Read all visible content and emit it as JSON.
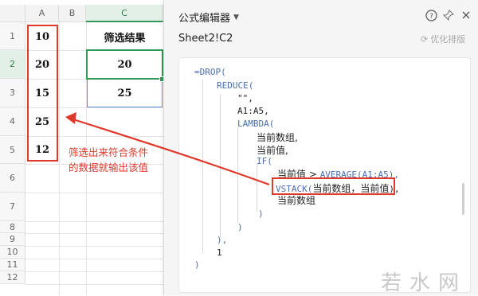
{
  "sheet": {
    "columns": [
      "A",
      "B",
      "C"
    ],
    "rows": [
      "1",
      "2",
      "3",
      "4",
      "5",
      "6",
      "7",
      "8",
      "9",
      "10",
      "11",
      "12"
    ],
    "column_a_values": [
      "10",
      "20",
      "15",
      "25",
      "12"
    ],
    "c1_header": "筛选结果",
    "results": [
      "20",
      "25"
    ]
  },
  "annotation": {
    "line1": "筛选出来符合条件",
    "line2": "的数据就输出该值"
  },
  "editor": {
    "title": "公式编辑器",
    "cell_ref": "Sheet2!C2",
    "optimize_label": "优化排版",
    "code": {
      "l1": "=DROP(",
      "l2": "REDUCE(",
      "l3": "\"\",",
      "l4": "A1:A5,",
      "l5": "LAMBDA(",
      "l6": "当前数组,",
      "l7": "当前值,",
      "l8": "IF(",
      "l9_a": "当前值 > ",
      "l9_b": "AVERAGE(A1:A5),",
      "l10_a": "VSTACK(",
      "l10_b": "当前数组，当前值",
      "l10_c": "),",
      "l11": "当前数组",
      "l12": ")",
      "l13": ")",
      "l14": "),",
      "l15": "1",
      "l16": ")"
    }
  },
  "watermark": "若水网",
  "colors": {
    "annotation_red": "#e0392b",
    "selection_green": "#2f9a57",
    "keyword_blue": "#4a6fb0"
  }
}
